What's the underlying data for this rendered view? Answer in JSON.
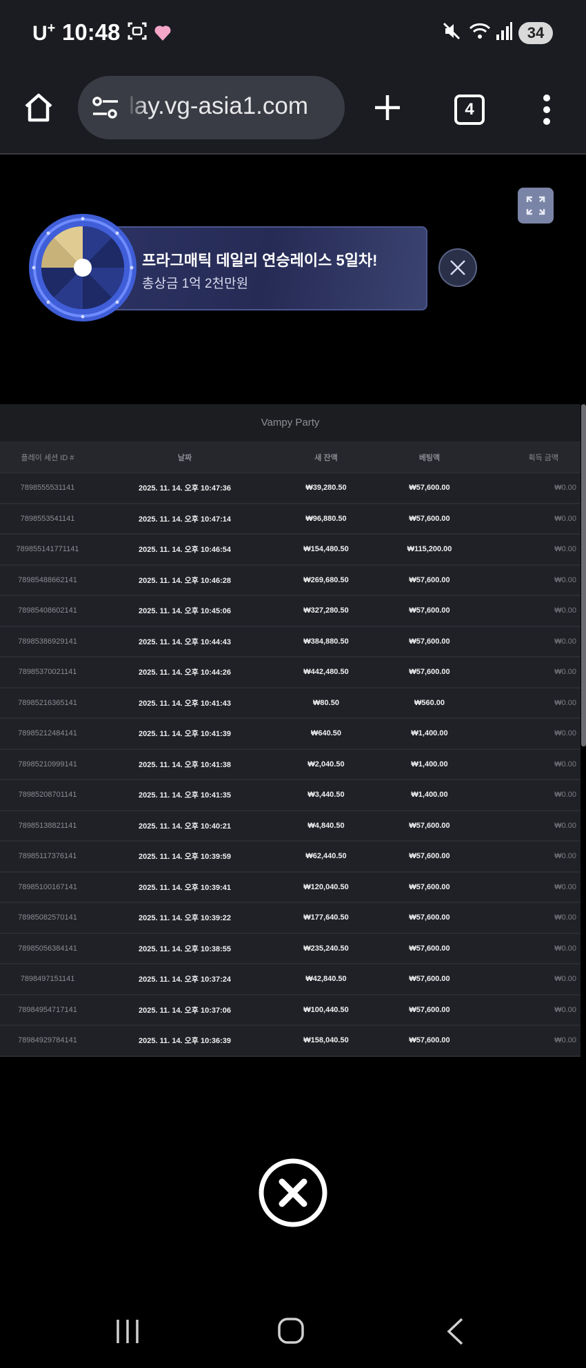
{
  "status_bar": {
    "carrier": "U",
    "carrier_sup": "+",
    "time": "10:48",
    "battery": "34",
    "heart_color": "#f4a6c9"
  },
  "browser": {
    "url": "lay.vg-asia1.com",
    "tab_count": "4"
  },
  "promo": {
    "title": "프라그매틱 데일리 연승레이스 5일차!",
    "subtitle": "총상금 1억 2천만원"
  },
  "history": {
    "game_title": "Vampy Party",
    "columns": [
      "플레이 세션 ID #",
      "날짜",
      "새 잔액",
      "베팅액",
      "획득 금액"
    ],
    "rows": [
      {
        "id": "7898555531141",
        "date": "2025. 11. 14. 오후 10:47:36",
        "balance": "₩39,280.50",
        "bet": "₩57,600.00",
        "win": "₩0.00"
      },
      {
        "id": "7898553541141",
        "date": "2025. 11. 14. 오후 10:47:14",
        "balance": "₩96,880.50",
        "bet": "₩57,600.00",
        "win": "₩0.00"
      },
      {
        "id": "789855141771141",
        "date": "2025. 11. 14. 오후 10:46:54",
        "balance": "₩154,480.50",
        "bet": "₩115,200.00",
        "win": "₩0.00"
      },
      {
        "id": "78985488662141",
        "date": "2025. 11. 14. 오후 10:46:28",
        "balance": "₩269,680.50",
        "bet": "₩57,600.00",
        "win": "₩0.00"
      },
      {
        "id": "78985408602141",
        "date": "2025. 11. 14. 오후 10:45:06",
        "balance": "₩327,280.50",
        "bet": "₩57,600.00",
        "win": "₩0.00"
      },
      {
        "id": "78985386929141",
        "date": "2025. 11. 14. 오후 10:44:43",
        "balance": "₩384,880.50",
        "bet": "₩57,600.00",
        "win": "₩0.00"
      },
      {
        "id": "78985370021141",
        "date": "2025. 11. 14. 오후 10:44:26",
        "balance": "₩442,480.50",
        "bet": "₩57,600.00",
        "win": "₩0.00"
      },
      {
        "id": "78985216365141",
        "date": "2025. 11. 14. 오후 10:41:43",
        "balance": "₩80.50",
        "bet": "₩560.00",
        "win": "₩0.00"
      },
      {
        "id": "78985212484141",
        "date": "2025. 11. 14. 오후 10:41:39",
        "balance": "₩640.50",
        "bet": "₩1,400.00",
        "win": "₩0.00"
      },
      {
        "id": "78985210999141",
        "date": "2025. 11. 14. 오후 10:41:38",
        "balance": "₩2,040.50",
        "bet": "₩1,400.00",
        "win": "₩0.00"
      },
      {
        "id": "78985208701141",
        "date": "2025. 11. 14. 오후 10:41:35",
        "balance": "₩3,440.50",
        "bet": "₩1,400.00",
        "win": "₩0.00"
      },
      {
        "id": "78985138821141",
        "date": "2025. 11. 14. 오후 10:40:21",
        "balance": "₩4,840.50",
        "bet": "₩57,600.00",
        "win": "₩0.00"
      },
      {
        "id": "78985117376141",
        "date": "2025. 11. 14. 오후 10:39:59",
        "balance": "₩62,440.50",
        "bet": "₩57,600.00",
        "win": "₩0.00"
      },
      {
        "id": "78985100167141",
        "date": "2025. 11. 14. 오후 10:39:41",
        "balance": "₩120,040.50",
        "bet": "₩57,600.00",
        "win": "₩0.00"
      },
      {
        "id": "78985082570141",
        "date": "2025. 11. 14. 오후 10:39:22",
        "balance": "₩177,640.50",
        "bet": "₩57,600.00",
        "win": "₩0.00"
      },
      {
        "id": "78985056384141",
        "date": "2025. 11. 14. 오후 10:38:55",
        "balance": "₩235,240.50",
        "bet": "₩57,600.00",
        "win": "₩0.00"
      },
      {
        "id": "7898497151141",
        "date": "2025. 11. 14. 오후 10:37:24",
        "balance": "₩42,840.50",
        "bet": "₩57,600.00",
        "win": "₩0.00"
      },
      {
        "id": "78984954717141",
        "date": "2025. 11. 14. 오후 10:37:06",
        "balance": "₩100,440.50",
        "bet": "₩57,600.00",
        "win": "₩0.00"
      },
      {
        "id": "78984929784141",
        "date": "2025. 11. 14. 오후 10:36:39",
        "balance": "₩158,040.50",
        "bet": "₩57,600.00",
        "win": "₩0.00"
      }
    ]
  }
}
